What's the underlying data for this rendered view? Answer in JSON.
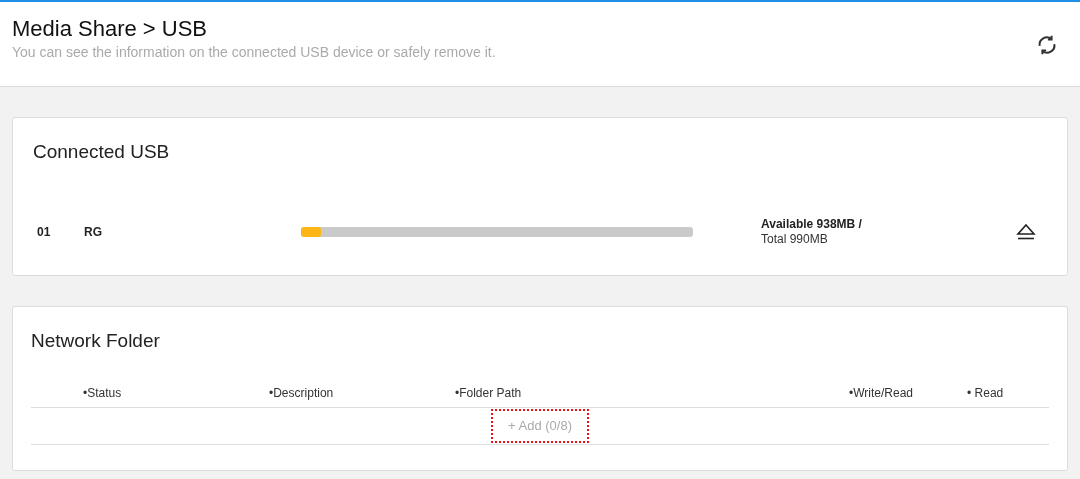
{
  "header": {
    "title": "Media Share > USB",
    "subtitle": "You can see the information on the connected USB device or safely remove it."
  },
  "connected_usb": {
    "title": "Connected USB",
    "devices": [
      {
        "index": "01",
        "name": "RG",
        "level": 0.05,
        "available": "Available 938MB /",
        "total": "Total 990MB"
      }
    ]
  },
  "network_folder": {
    "title": "Network Folder",
    "columns": [
      "•Status",
      "•Description",
      "•Folder Path",
      "•Write/Read",
      "• Read"
    ],
    "add_button": "+ Add (0/8)"
  }
}
